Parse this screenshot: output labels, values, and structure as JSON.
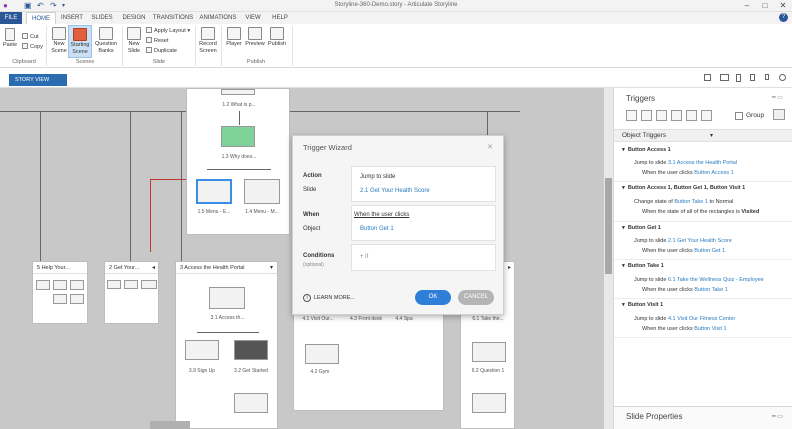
{
  "window": {
    "title": "Storyline-360-Demo.story - Articulate Storyline"
  },
  "tabs": [
    "FILE",
    "HOME",
    "INSERT",
    "SLIDES",
    "DESIGN",
    "TRANSITIONS",
    "ANIMATIONS",
    "VIEW",
    "HELP"
  ],
  "ribbon": {
    "paste": "Paste",
    "cut": "Cut",
    "copy": "Copy",
    "clipboard": "Clipboard",
    "new_scene": "New Scene",
    "starting_scene": "Starting Scene",
    "question_banks": "Question Banks",
    "scenes": "Scenes",
    "new_slide": "New Slide",
    "apply_layout": "Apply Layout",
    "reset": "Reset",
    "duplicate": "Duplicate",
    "slide": "Slide",
    "record_screen": "Record Screen",
    "player": "Player",
    "preview": "Preview",
    "publish": "Publish",
    "publish_group": "Publish"
  },
  "story_view": "STORY VIEW",
  "canvas": {
    "scene1_slides": [
      "1.2 What is p...",
      "1.3 Why does...",
      "1.5 Menu - E...",
      "1.4 Menu - M..."
    ],
    "scene5": "5 Help Your...",
    "scene2": "2 Get Your...",
    "scene3": "3 Access the Health Portal",
    "scene3_slides": [
      "3.1 Access th...",
      "3.9 Sign Up",
      "3.2 Get Started"
    ],
    "scene4_slides": [
      "4.1 Visit Our...",
      "4.3 Front desk",
      "4.4 Spa",
      "4.2 Gym"
    ],
    "scene6_slides": [
      "6.1 Take the...",
      "6.2 Question 1"
    ]
  },
  "wizard": {
    "title": "Trigger Wizard",
    "action_label": "Action",
    "action_value": "Jump to slide",
    "slide_label": "Slide",
    "slide_value": "2.1 Get Your Health Score",
    "when_label": "When",
    "when_value": "When the user clicks",
    "object_label": "Object",
    "object_value": "Button Get 1",
    "conditions_label": "Conditions",
    "conditions_optional": "(optional)",
    "add_if": "+ if",
    "learn_more": "LEARN MORE...",
    "ok": "OK",
    "cancel": "CANCEL"
  },
  "panel": {
    "triggers_title": "Triggers",
    "group": "Group",
    "object_triggers": "Object Triggers",
    "slide_properties": "Slide Properties",
    "items": [
      {
        "header": "Button Access 1",
        "action": "Jump to slide ",
        "action_link": "3.1 Access the Health Portal",
        "cond": "When the user clicks ",
        "cond_link": "Button Access 1",
        "cond_tail": ""
      },
      {
        "header": "Button Access 1, Button Get 1, Button Visit 1",
        "action": "Change state of ",
        "action_link": "Button Take 1",
        "action_tail": " to Normal",
        "cond": "When the state of all of the rectangles is ",
        "cond_link": "",
        "cond_tail": "Visited"
      },
      {
        "header": "Button Get 1",
        "action": "Jump to slide ",
        "action_link": "2.1 Get Your Health Score",
        "cond": "When the user clicks ",
        "cond_link": "Button Get 1",
        "cond_tail": ""
      },
      {
        "header": "Button Take 1",
        "action": "Jump to slide ",
        "action_link": "6.1 Take the Wellness Quiz - Employee",
        "cond": "When the user clicks ",
        "cond_link": "Button Take 1",
        "cond_tail": ""
      },
      {
        "header": "Button Visit 1",
        "action": "Jump to slide ",
        "action_link": "4.1 Visit Our Fitness Center",
        "cond": "When the user clicks ",
        "cond_link": "Button Visit 1",
        "cond_tail": ""
      }
    ]
  },
  "colors": {
    "accent": "#2b5797",
    "link": "#2a7bbf",
    "ok": "#2f7fd8",
    "cancel": "#b5b5b5",
    "canvas": "#c8c8c8"
  }
}
